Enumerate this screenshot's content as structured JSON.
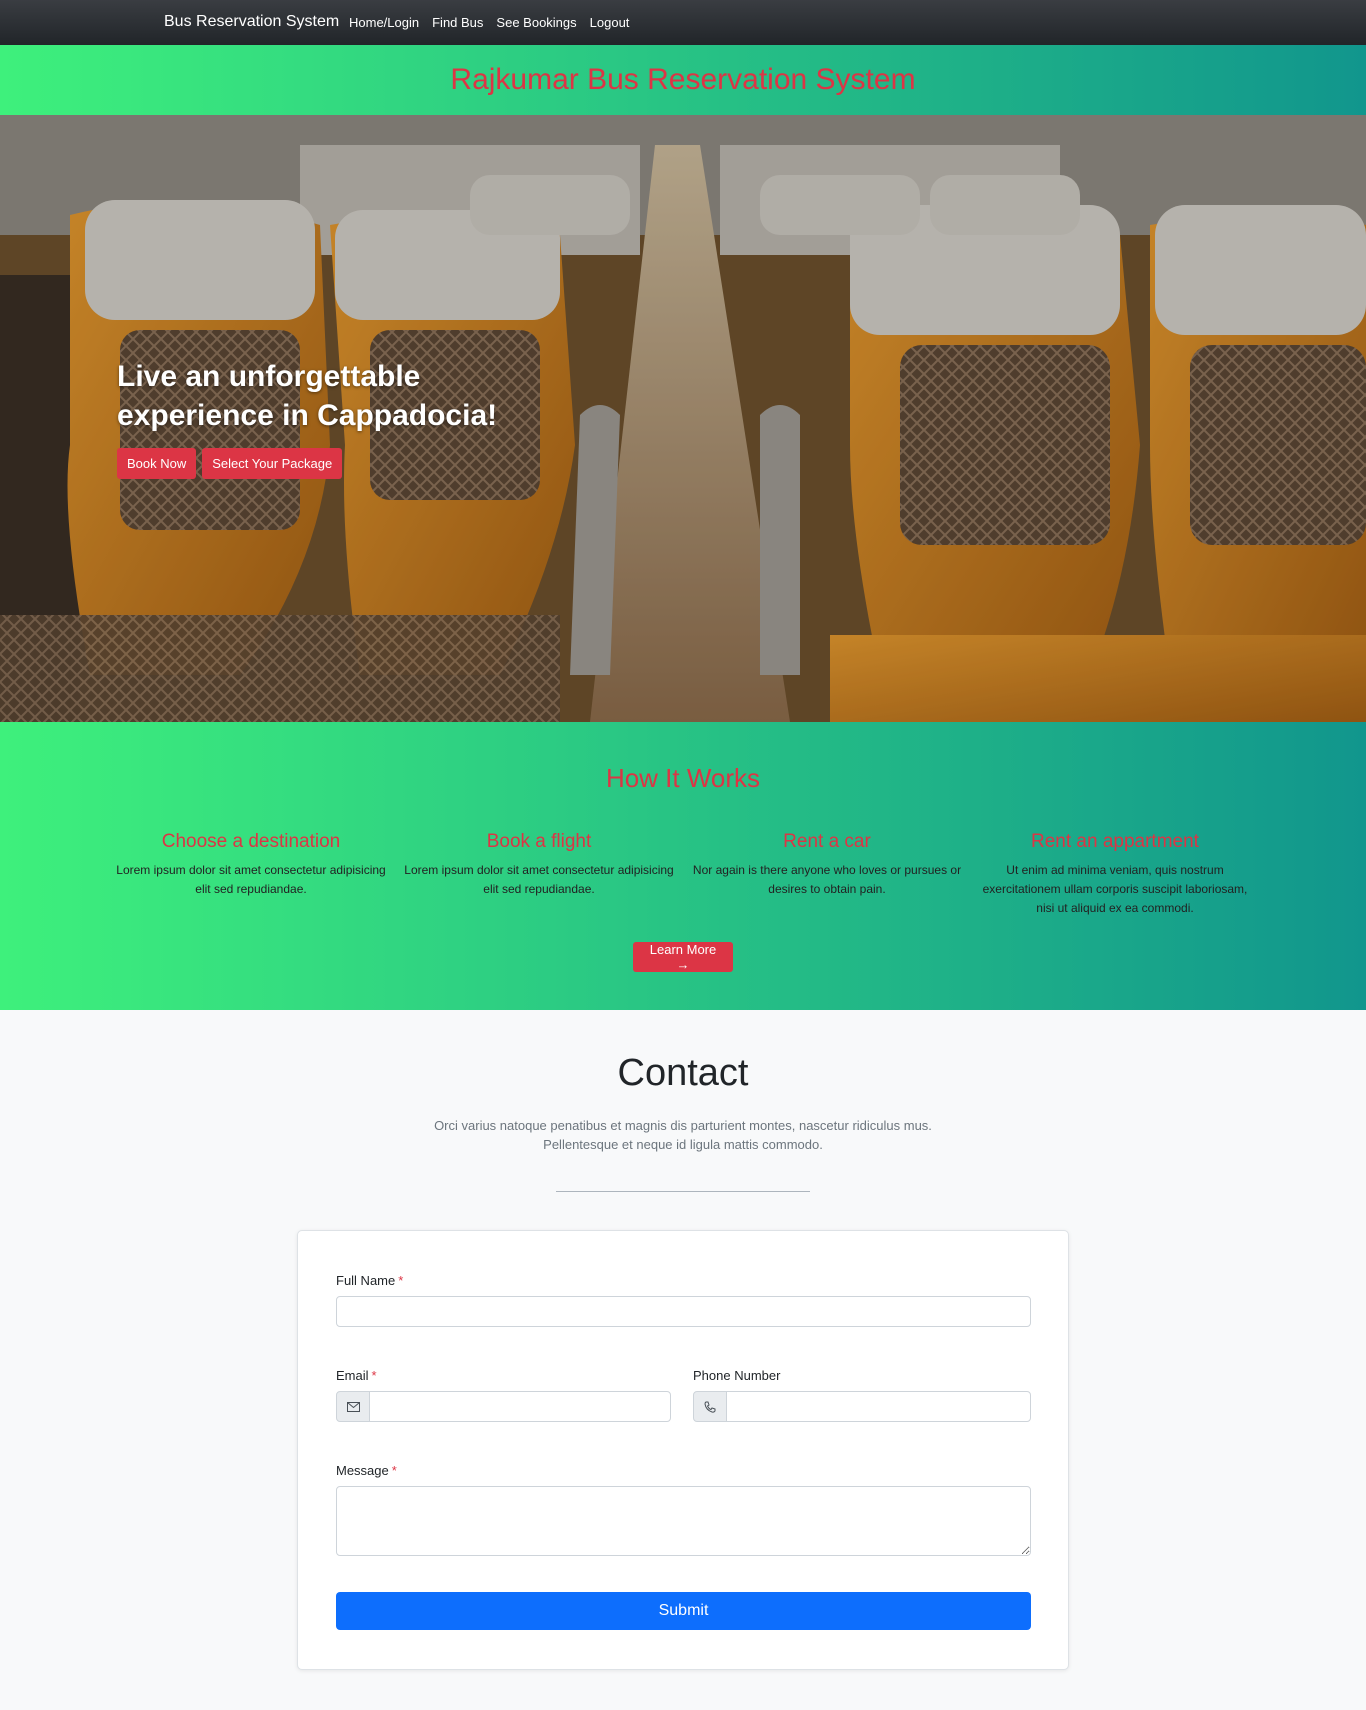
{
  "nav": {
    "brand": "Bus Reservation System",
    "links": [
      "Home/Login",
      "Find Bus",
      "See Bookings",
      "Logout"
    ]
  },
  "banner": {
    "title": "Rajkumar Bus Reservation System"
  },
  "hero": {
    "heading_line1": "Live an unforgettable",
    "heading_line2": "experience in Cappadocia!",
    "book_label": "Book Now",
    "package_label": "Select Your Package"
  },
  "how": {
    "title": "How It Works",
    "steps": [
      {
        "title": "Choose a destination",
        "text": "Lorem ipsum dolor sit amet consectetur adipisicing elit sed repudiandae."
      },
      {
        "title": "Book a flight",
        "text": "Lorem ipsum dolor sit amet consectetur adipisicing elit sed repudiandae."
      },
      {
        "title": "Rent a car",
        "text": "Nor again is there anyone who loves or pursues or desires to obtain pain."
      },
      {
        "title": "Rent an appartment",
        "text": "Ut enim ad minima veniam, quis nostrum exercitationem ullam corporis suscipit laboriosam, nisi ut aliquid ex ea commodi."
      }
    ],
    "learn_label": "Learn More →"
  },
  "contact": {
    "title": "Contact",
    "desc_line1": "Orci varius natoque penatibus et magnis dis parturient montes, nascetur ridiculus mus.",
    "desc_line2": "Pellentesque et neque id ligula mattis commodo.",
    "form": {
      "fullname_label": "Full Name",
      "email_label": "Email",
      "phone_label": "Phone Number",
      "message_label": "Message",
      "required_mark": "*",
      "fullname_value": "",
      "email_value": "",
      "phone_value": "",
      "message_value": "",
      "submit_label": "Submit"
    }
  },
  "colors": {
    "accent_red": "#dc3545",
    "gradient_start": "#3ef07c",
    "gradient_end": "#11968d",
    "submit_blue": "#0d6efd"
  },
  "icons": {
    "email": "envelope-icon",
    "phone": "phone-icon"
  }
}
